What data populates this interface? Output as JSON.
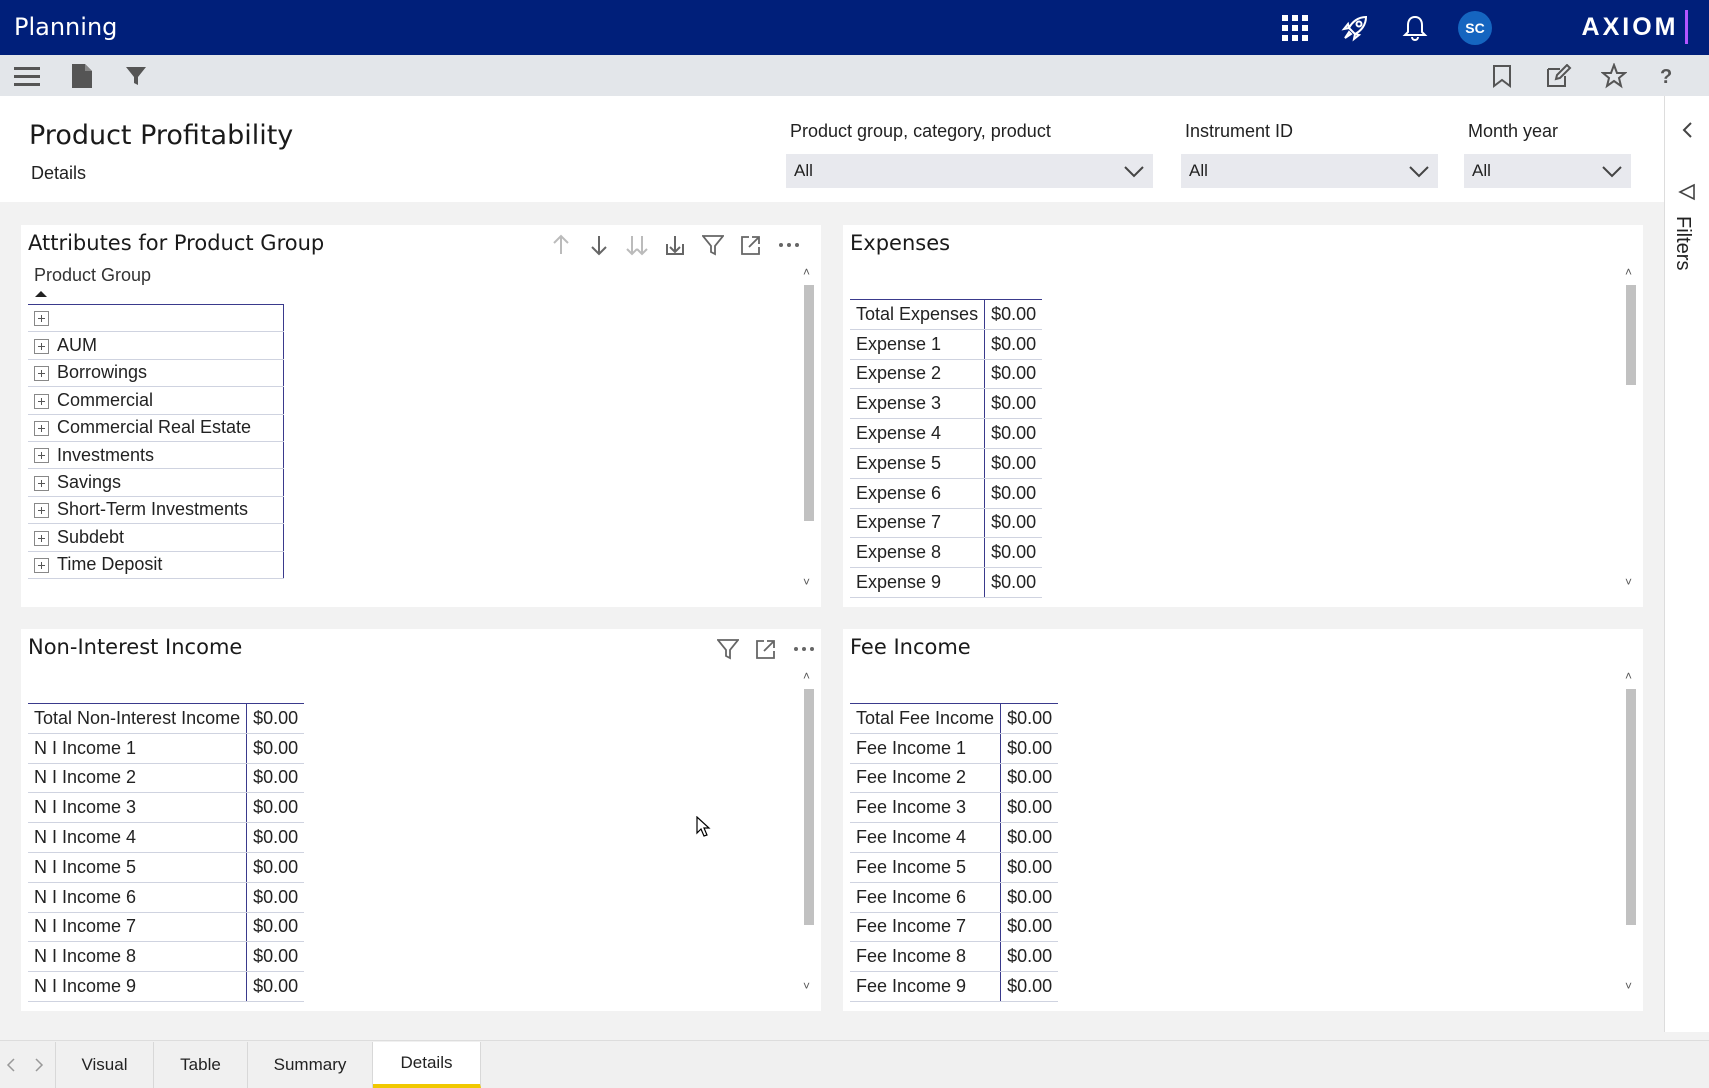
{
  "app": {
    "title": "Planning",
    "logo_text": "AXIOM",
    "user_initials": "SC"
  },
  "page": {
    "title": "Product Profitability",
    "subtitle": "Details"
  },
  "filters": [
    {
      "label": "Product group, category, product",
      "value": "All"
    },
    {
      "label": "Instrument ID",
      "value": "All"
    },
    {
      "label": "Month year",
      "value": "All"
    }
  ],
  "filters_rail": {
    "label": "Filters"
  },
  "attributes_panel": {
    "title": "Attributes for Product Group",
    "column_header": "Product Group",
    "rows": [
      "",
      "AUM",
      "Borrowings",
      "Commercial",
      "Commercial Real Estate",
      "Investments",
      "Savings",
      "Short-Term Investments",
      "Subdebt",
      "Time Deposit"
    ]
  },
  "expenses_panel": {
    "title": "Expenses",
    "rows": [
      {
        "label": "Total Expenses",
        "value": "$0.00"
      },
      {
        "label": "Expense 1",
        "value": "$0.00"
      },
      {
        "label": "Expense 2",
        "value": "$0.00"
      },
      {
        "label": "Expense 3",
        "value": "$0.00"
      },
      {
        "label": "Expense 4",
        "value": "$0.00"
      },
      {
        "label": "Expense 5",
        "value": "$0.00"
      },
      {
        "label": "Expense 6",
        "value": "$0.00"
      },
      {
        "label": "Expense 7",
        "value": "$0.00"
      },
      {
        "label": "Expense 8",
        "value": "$0.00"
      },
      {
        "label": "Expense 9",
        "value": "$0.00"
      }
    ]
  },
  "nii_panel": {
    "title": "Non-Interest Income",
    "rows": [
      {
        "label": "Total Non-Interest Income",
        "value": "$0.00"
      },
      {
        "label": "N I Income 1",
        "value": "$0.00"
      },
      {
        "label": "N I Income 2",
        "value": "$0.00"
      },
      {
        "label": "N I Income 3",
        "value": "$0.00"
      },
      {
        "label": "N I Income 4",
        "value": "$0.00"
      },
      {
        "label": "N I Income 5",
        "value": "$0.00"
      },
      {
        "label": "N I Income 6",
        "value": "$0.00"
      },
      {
        "label": "N I Income 7",
        "value": "$0.00"
      },
      {
        "label": "N I Income 8",
        "value": "$0.00"
      },
      {
        "label": "N I Income 9",
        "value": "$0.00"
      }
    ]
  },
  "fee_panel": {
    "title": "Fee Income",
    "rows": [
      {
        "label": "Total Fee Income",
        "value": "$0.00"
      },
      {
        "label": "Fee Income 1",
        "value": "$0.00"
      },
      {
        "label": "Fee Income 2",
        "value": "$0.00"
      },
      {
        "label": "Fee Income 3",
        "value": "$0.00"
      },
      {
        "label": "Fee Income 4",
        "value": "$0.00"
      },
      {
        "label": "Fee Income 5",
        "value": "$0.00"
      },
      {
        "label": "Fee Income 6",
        "value": "$0.00"
      },
      {
        "label": "Fee Income 7",
        "value": "$0.00"
      },
      {
        "label": "Fee Income 8",
        "value": "$0.00"
      },
      {
        "label": "Fee Income 9",
        "value": "$0.00"
      }
    ]
  },
  "tabs": [
    {
      "label": "Visual",
      "active": false
    },
    {
      "label": "Table",
      "active": false
    },
    {
      "label": "Summary",
      "active": false
    },
    {
      "label": "Details",
      "active": true
    }
  ],
  "colors": {
    "topbar": "#001f7a",
    "active_tab": "#f0c800",
    "table_border": "#3a3a8c"
  }
}
